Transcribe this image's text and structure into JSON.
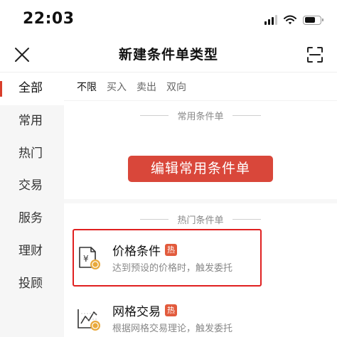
{
  "status_bar": {
    "time": "22:03"
  },
  "nav": {
    "title": "新建条件单类型"
  },
  "sidebar": {
    "items": [
      {
        "label": "全部",
        "active": true
      },
      {
        "label": "常用",
        "active": false
      },
      {
        "label": "热门",
        "active": false
      },
      {
        "label": "交易",
        "active": false
      },
      {
        "label": "服务",
        "active": false
      },
      {
        "label": "理财",
        "active": false
      },
      {
        "label": "投顾",
        "active": false
      }
    ]
  },
  "filters": {
    "tabs": [
      {
        "label": "不限",
        "active": true
      },
      {
        "label": "买入",
        "active": false
      },
      {
        "label": "卖出",
        "active": false
      },
      {
        "label": "双向",
        "active": false
      }
    ]
  },
  "sections": {
    "common": {
      "label": "常用条件单",
      "edit_button": "编辑常用条件单"
    },
    "hot": {
      "label": "热门条件单",
      "items": [
        {
          "title": "价格条件",
          "badge": "热",
          "desc": "达到预设的价格时，触发委托"
        },
        {
          "title": "网格交易",
          "badge": "热",
          "desc": "根据网格交易理论，触发委托"
        }
      ]
    }
  },
  "colors": {
    "accent": "#d9473a",
    "highlight": "#e02020",
    "badge": "#e25b3d",
    "coin": "#e9a93a"
  }
}
